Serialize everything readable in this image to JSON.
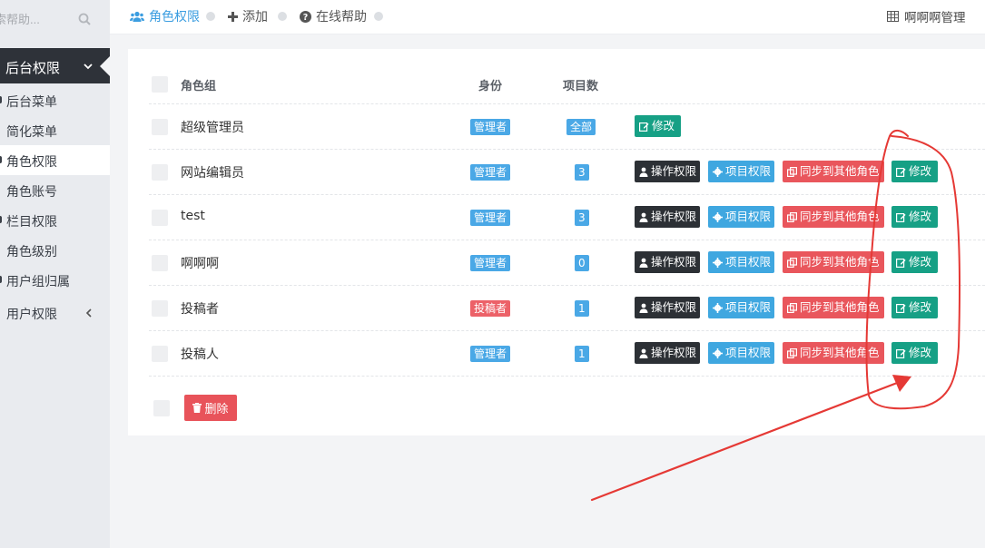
{
  "sidebar": {
    "search_placeholder": "索帮助...",
    "group_title": "后台权限",
    "items": [
      {
        "label": "后台菜单",
        "dot": true
      },
      {
        "label": "简化菜单",
        "dot": false
      },
      {
        "label": "角色权限",
        "dot": true,
        "active": true
      },
      {
        "label": "角色账号",
        "dot": false
      },
      {
        "label": "栏目权限",
        "dot": true
      },
      {
        "label": "角色级别",
        "dot": false
      },
      {
        "label": "用户组归属",
        "dot": true
      },
      {
        "label": "用户权限",
        "dot": false,
        "chevron": true
      }
    ]
  },
  "topbar": {
    "crumb_role": "角色权限",
    "crumb_add": "添加",
    "crumb_help": "在线帮助",
    "manage": "啊啊啊管理"
  },
  "table": {
    "headers": {
      "group": "角色组",
      "identity": "身份",
      "count": "项目数"
    },
    "rows": [
      {
        "name": "超级管理员",
        "identity": "管理者",
        "count": "全部"
      },
      {
        "name": "网站编辑员",
        "identity": "管理者",
        "count": "3"
      },
      {
        "name": "test",
        "identity": "管理者",
        "count": "3"
      },
      {
        "name": "啊啊啊",
        "identity": "管理者",
        "count": "0"
      },
      {
        "name": "投稿者",
        "identity": "投稿者",
        "count": "1"
      },
      {
        "name": "投稿人",
        "identity": "管理者",
        "count": "1"
      }
    ],
    "actions": {
      "op": "操作权限",
      "proj": "项目权限",
      "sync": "同步到其他角色",
      "edit": "修改"
    },
    "delete_label": "删除"
  },
  "colors": {
    "accent": "#3b9de0",
    "sidebar_dark": "#2e3239",
    "badge_blue": "#4aa8e6",
    "badge_red": "#ec6168",
    "btn_teal": "#16a085",
    "btn_danger": "#e9565c",
    "annotation": "#e53935"
  }
}
